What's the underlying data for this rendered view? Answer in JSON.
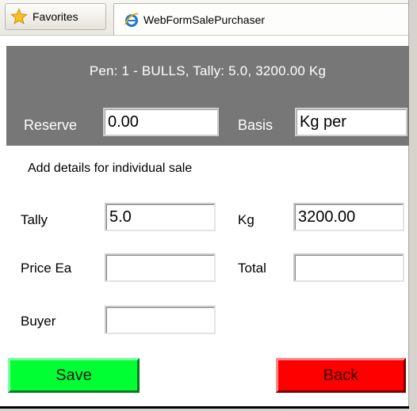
{
  "toolbar": {
    "favorites_label": "Favorites",
    "tab_title": "WebFormSalePurchaser"
  },
  "header": {
    "pen_info": "Pen: 1 - BULLS, Tally: 5.0, 3200.00 Kg",
    "reserve_label": "Reserve",
    "reserve_value": "0.00",
    "basis_label": "Basis",
    "basis_value": "Kg per"
  },
  "form": {
    "subtitle": "Add details for individual sale",
    "tally_label": "Tally",
    "tally_value": "5.0",
    "kg_label": "Kg",
    "kg_value": "3200.00",
    "price_label": "Price Ea",
    "price_value": "",
    "total_label": "Total",
    "total_value": "",
    "buyer_label": "Buyer",
    "buyer_value": ""
  },
  "actions": {
    "save_label": "Save",
    "back_label": "Back"
  },
  "colors": {
    "panel": "#777777",
    "save": "#00ff33",
    "back": "#ff0000"
  },
  "icons": {
    "favorites": "star-icon",
    "tab": "ie-icon"
  }
}
